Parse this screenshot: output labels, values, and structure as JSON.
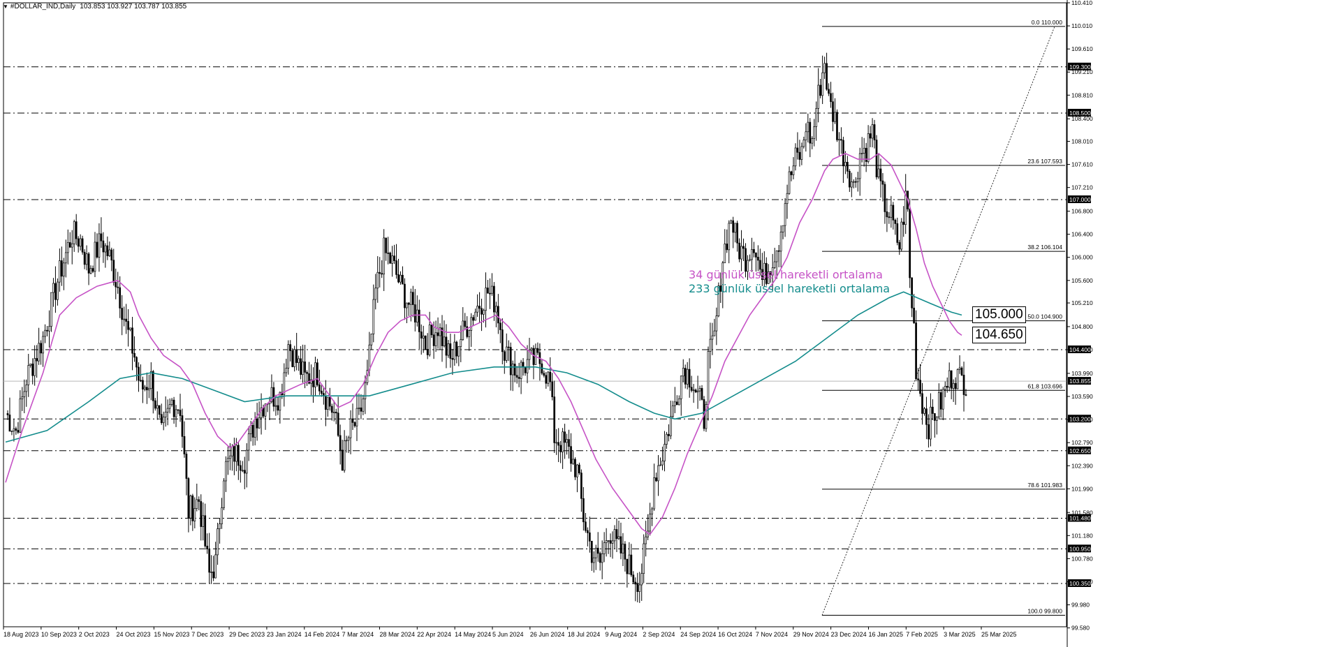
{
  "header": {
    "title": "#DOLLAR_IND,Daily",
    "ohlc": "103.853 103.927 103.787 103.855",
    "menu_icon": "triangle-down-icon"
  },
  "legend": {
    "ema34": "34 günlük üssel hareketli ortalama",
    "ema233": "233 günlük üssel hareketli ortalama",
    "ema34_color": "#c653c6",
    "ema233_color": "#138c8c"
  },
  "targets": [
    "105.000",
    "104.650"
  ],
  "current_price": "103.855",
  "chart_data": {
    "type": "candlestick",
    "symbol": "#DOLLAR_IND",
    "timeframe": "Daily",
    "ylim": [
      99.6,
      110.41
    ],
    "y_ticks": [
      "110.410",
      "110.010",
      "109.610",
      "109.210",
      "108.810",
      "108.400",
      "108.010",
      "107.610",
      "107.210",
      "106.800",
      "106.400",
      "106.000",
      "105.600",
      "105.210",
      "104.800",
      "104.400",
      "103.990",
      "103.590",
      "103.190",
      "102.790",
      "102.390",
      "101.990",
      "101.580",
      "101.180",
      "100.780",
      "100.380",
      "99.980",
      "99.580"
    ],
    "x_ticks": [
      "18 Aug 2023",
      "10 Sep 2023",
      "2 Oct 2023",
      "24 Oct 2023",
      "15 Nov 2023",
      "7 Dec 2023",
      "29 Dec 2023",
      "23 Jan 2024",
      "14 Feb 2024",
      "7 Mar 2024",
      "28 Mar 2024",
      "22 Apr 2024",
      "14 May 2024",
      "5 Jun 2024",
      "26 Jun 2024",
      "18 Jul 2024",
      "9 Aug 2024",
      "2 Sep 2024",
      "24 Sep 2024",
      "16 Oct 2024",
      "7 Nov 2024",
      "29 Nov 2024",
      "23 Dec 2024",
      "16 Jan 2025",
      "7 Feb 2025",
      "3 Mar 2025",
      "25 Mar 2025"
    ],
    "horizontal_levels": [
      "109.300",
      "108.500",
      "107.000",
      "104.400",
      "103.200",
      "102.650",
      "101.480",
      "100.950",
      "100.350"
    ],
    "fibonacci": [
      {
        "label": "0.0 110.000",
        "value": 110.0
      },
      {
        "label": "23.6 107.593",
        "value": 107.593
      },
      {
        "label": "38.2 106.104",
        "value": 106.104
      },
      {
        "label": "50.0 104.900",
        "value": 104.9
      },
      {
        "label": "61.8 103.696",
        "value": 103.696
      },
      {
        "label": "78.6 101.983",
        "value": 101.983
      },
      {
        "label": "100.0 99.800",
        "value": 99.8
      }
    ],
    "price_path": [
      [
        0,
        103.3
      ],
      [
        5,
        103.0
      ],
      [
        10,
        103.9
      ],
      [
        18,
        104.6
      ],
      [
        25,
        105.6
      ],
      [
        32,
        106.4
      ],
      [
        36,
        106.3
      ],
      [
        40,
        105.8
      ],
      [
        46,
        106.3
      ],
      [
        50,
        106.0
      ],
      [
        54,
        105.5
      ],
      [
        58,
        104.8
      ],
      [
        62,
        104.3
      ],
      [
        65,
        103.7
      ],
      [
        70,
        103.9
      ],
      [
        75,
        102.9
      ],
      [
        80,
        103.5
      ],
      [
        84,
        103.4
      ],
      [
        88,
        101.6
      ],
      [
        93,
        101.8
      ],
      [
        98,
        100.5
      ],
      [
        101,
        100.7
      ],
      [
        105,
        102.3
      ],
      [
        110,
        102.6
      ],
      [
        115,
        102.5
      ],
      [
        120,
        103.2
      ],
      [
        126,
        103.6
      ],
      [
        132,
        103.6
      ],
      [
        136,
        104.5
      ],
      [
        140,
        104.2
      ],
      [
        144,
        103.9
      ],
      [
        150,
        104.0
      ],
      [
        154,
        103.6
      ],
      [
        158,
        103.3
      ],
      [
        162,
        102.5
      ],
      [
        166,
        103.0
      ],
      [
        170,
        103.2
      ],
      [
        174,
        103.9
      ],
      [
        178,
        105.4
      ],
      [
        182,
        106.1
      ],
      [
        186,
        105.9
      ],
      [
        190,
        105.5
      ],
      [
        194,
        105.2
      ],
      [
        198,
        105.0
      ],
      [
        202,
        104.5
      ],
      [
        208,
        104.8
      ],
      [
        214,
        104.2
      ],
      [
        220,
        104.7
      ],
      [
        226,
        105.1
      ],
      [
        232,
        105.4
      ],
      [
        236,
        105.2
      ],
      [
        240,
        104.4
      ],
      [
        246,
        104.0
      ],
      [
        252,
        104.2
      ],
      [
        258,
        104.2
      ],
      [
        262,
        103.8
      ],
      [
        264,
        102.9
      ],
      [
        270,
        102.7
      ],
      [
        275,
        102.3
      ],
      [
        278,
        101.5
      ],
      [
        282,
        100.9
      ],
      [
        286,
        100.7
      ],
      [
        290,
        101.3
      ],
      [
        294,
        101.0
      ],
      [
        298,
        100.8
      ],
      [
        302,
        100.5
      ],
      [
        305,
        100.4
      ],
      [
        307,
        100.8
      ],
      [
        309,
        101.2
      ],
      [
        312,
        102.2
      ],
      [
        316,
        102.6
      ],
      [
        322,
        103.5
      ],
      [
        326,
        104.1
      ],
      [
        330,
        103.9
      ],
      [
        334,
        103.5
      ],
      [
        336,
        103.2
      ],
      [
        338,
        104.2
      ],
      [
        341,
        104.6
      ],
      [
        345,
        106.0
      ],
      [
        349,
        106.7
      ],
      [
        352,
        106.2
      ],
      [
        356,
        106.0
      ],
      [
        360,
        106.3
      ],
      [
        364,
        105.6
      ],
      [
        368,
        105.9
      ],
      [
        372,
        106.3
      ],
      [
        376,
        107.2
      ],
      [
        380,
        107.7
      ],
      [
        383,
        107.8
      ],
      [
        385,
        108.3
      ],
      [
        388,
        108.0
      ],
      [
        390,
        108.6
      ],
      [
        394,
        109.4
      ],
      [
        396,
        108.7
      ],
      [
        399,
        108.4
      ],
      [
        402,
        107.9
      ],
      [
        405,
        107.6
      ],
      [
        408,
        107.2
      ],
      [
        411,
        107.8
      ],
      [
        414,
        107.9
      ],
      [
        417,
        108.2
      ],
      [
        420,
        107.3
      ],
      [
        424,
        106.8
      ],
      [
        426,
        106.7
      ],
      [
        428,
        106.4
      ],
      [
        430,
        106.2
      ],
      [
        433,
        107.0
      ],
      [
        434,
        106.8
      ],
      [
        435,
        105.6
      ],
      [
        437,
        104.8
      ],
      [
        438,
        104.1
      ],
      [
        441,
        103.5
      ],
      [
        444,
        103.1
      ],
      [
        447,
        103.3
      ],
      [
        450,
        103.5
      ],
      [
        453,
        103.8
      ],
      [
        456,
        104.0
      ],
      [
        459,
        103.9
      ],
      [
        462,
        103.85
      ]
    ],
    "ema34_path": [
      [
        0,
        102.1
      ],
      [
        8,
        103.0
      ],
      [
        18,
        104.0
      ],
      [
        26,
        105.0
      ],
      [
        34,
        105.3
      ],
      [
        44,
        105.5
      ],
      [
        54,
        105.6
      ],
      [
        60,
        105.4
      ],
      [
        64,
        105.0
      ],
      [
        70,
        104.6
      ],
      [
        76,
        104.3
      ],
      [
        84,
        104.1
      ],
      [
        90,
        103.8
      ],
      [
        96,
        103.3
      ],
      [
        102,
        102.9
      ],
      [
        108,
        102.7
      ],
      [
        112,
        102.8
      ],
      [
        118,
        103.1
      ],
      [
        124,
        103.4
      ],
      [
        130,
        103.6
      ],
      [
        136,
        103.7
      ],
      [
        142,
        103.8
      ],
      [
        150,
        103.9
      ],
      [
        156,
        103.6
      ],
      [
        160,
        103.4
      ],
      [
        166,
        103.5
      ],
      [
        172,
        103.8
      ],
      [
        178,
        104.3
      ],
      [
        184,
        104.7
      ],
      [
        190,
        104.9
      ],
      [
        196,
        105.0
      ],
      [
        202,
        105.0
      ],
      [
        206,
        104.8
      ],
      [
        212,
        104.7
      ],
      [
        218,
        104.7
      ],
      [
        224,
        104.8
      ],
      [
        230,
        104.9
      ],
      [
        236,
        105.0
      ],
      [
        242,
        104.8
      ],
      [
        248,
        104.5
      ],
      [
        254,
        104.3
      ],
      [
        260,
        104.2
      ],
      [
        266,
        103.9
      ],
      [
        272,
        103.5
      ],
      [
        278,
        103.0
      ],
      [
        284,
        102.5
      ],
      [
        292,
        102.0
      ],
      [
        300,
        101.6
      ],
      [
        306,
        101.3
      ],
      [
        310,
        101.2
      ],
      [
        316,
        101.5
      ],
      [
        322,
        102.0
      ],
      [
        328,
        102.6
      ],
      [
        334,
        103.1
      ],
      [
        340,
        103.6
      ],
      [
        346,
        104.2
      ],
      [
        352,
        104.6
      ],
      [
        358,
        105.0
      ],
      [
        364,
        105.3
      ],
      [
        370,
        105.6
      ],
      [
        376,
        106.0
      ],
      [
        382,
        106.6
      ],
      [
        388,
        107.0
      ],
      [
        394,
        107.5
      ],
      [
        398,
        107.7
      ],
      [
        404,
        107.8
      ],
      [
        410,
        107.7
      ],
      [
        416,
        107.7
      ],
      [
        420,
        107.8
      ],
      [
        426,
        107.6
      ],
      [
        430,
        107.3
      ],
      [
        434,
        107.0
      ],
      [
        438,
        106.5
      ],
      [
        442,
        105.9
      ],
      [
        446,
        105.5
      ],
      [
        450,
        105.2
      ],
      [
        454,
        104.9
      ],
      [
        458,
        104.7
      ],
      [
        460,
        104.65
      ]
    ],
    "ema233_path": [
      [
        0,
        102.8
      ],
      [
        20,
        103.0
      ],
      [
        40,
        103.5
      ],
      [
        55,
        103.9
      ],
      [
        70,
        104.0
      ],
      [
        85,
        103.9
      ],
      [
        100,
        103.7
      ],
      [
        115,
        103.5
      ],
      [
        135,
        103.6
      ],
      [
        155,
        103.6
      ],
      [
        175,
        103.6
      ],
      [
        195,
        103.8
      ],
      [
        215,
        104.0
      ],
      [
        235,
        104.1
      ],
      [
        255,
        104.1
      ],
      [
        270,
        104.0
      ],
      [
        285,
        103.8
      ],
      [
        300,
        103.5
      ],
      [
        312,
        103.3
      ],
      [
        322,
        103.2
      ],
      [
        335,
        103.3
      ],
      [
        350,
        103.6
      ],
      [
        365,
        103.9
      ],
      [
        380,
        104.2
      ],
      [
        395,
        104.6
      ],
      [
        410,
        105.0
      ],
      [
        425,
        105.3
      ],
      [
        432,
        105.4
      ],
      [
        445,
        105.2
      ],
      [
        455,
        105.05
      ],
      [
        460,
        105.0
      ]
    ]
  }
}
